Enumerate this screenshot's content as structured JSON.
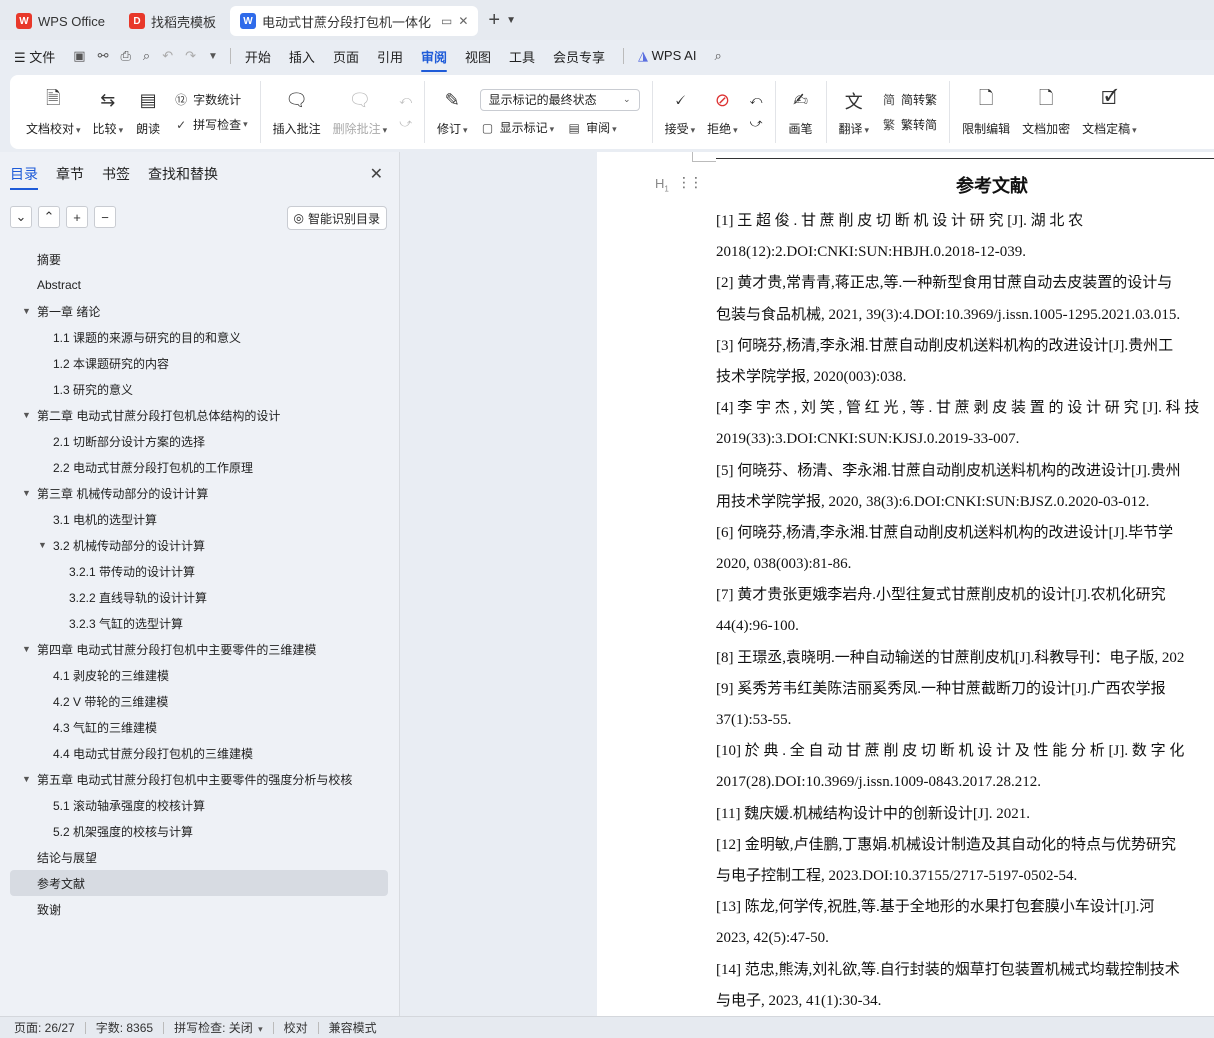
{
  "tabs": [
    {
      "label": "WPS Office",
      "icon": "wps-logo-icon",
      "color": "#e8382a"
    },
    {
      "label": "找稻壳模板",
      "icon": "docer-icon",
      "color": "#e8382a"
    },
    {
      "label": "电动式甘蔗分段打包机一体化",
      "icon": "writer-icon",
      "color": "#2f6bea",
      "active": true
    }
  ],
  "menu": {
    "file": "文件",
    "items": [
      "开始",
      "插入",
      "页面",
      "引用",
      "审阅",
      "视图",
      "工具",
      "会员专享"
    ],
    "active": "审阅",
    "ai": "WPS AI"
  },
  "ribbon": {
    "proofread": "文档校对",
    "compare": "比较",
    "read_aloud": "朗读",
    "word_count": "字数统计",
    "spell_check": "拼写检查",
    "insert_comment": "插入批注",
    "delete_comment": "删除批注",
    "revise": "修订",
    "markup_state": "显示标记的最终状态",
    "show_markup": "显示标记",
    "review": "审阅",
    "accept": "接受",
    "reject": "拒绝",
    "brush": "画笔",
    "translate": "翻译",
    "to_traditional": "简转繁",
    "to_simplified": "繁转简",
    "restrict_edit": "限制编辑",
    "encrypt": "文档加密",
    "finalize": "文档定稿"
  },
  "nav": {
    "tabs": [
      "目录",
      "章节",
      "书签",
      "查找和替换"
    ],
    "active_tab": "目录",
    "smart_button": "智能识别目录",
    "toc": [
      {
        "label": "摘要",
        "level": 1,
        "expand": false
      },
      {
        "label": "Abstract",
        "level": 1,
        "expand": false
      },
      {
        "label": "第一章  绪论",
        "level": 1,
        "expand": true
      },
      {
        "label": "1.1  课题的来源与研究的目的和意义",
        "level": 2,
        "expand": false
      },
      {
        "label": "1.2  本课题研究的内容",
        "level": 2,
        "expand": false
      },
      {
        "label": "1.3  研究的意义",
        "level": 2,
        "expand": false
      },
      {
        "label": "第二章  电动式甘蔗分段打包机总体结构的设计",
        "level": 1,
        "expand": true
      },
      {
        "label": "2.1 切断部分设计方案的选择",
        "level": 2,
        "expand": false
      },
      {
        "label": "2.2 电动式甘蔗分段打包机的工作原理",
        "level": 2,
        "expand": false
      },
      {
        "label": "第三章  机械传动部分的设计计算",
        "level": 1,
        "expand": true
      },
      {
        "label": "3.1 电机的选型计算",
        "level": 2,
        "expand": false
      },
      {
        "label": "3.2  机械传动部分的设计计算",
        "level": 2,
        "expand": true
      },
      {
        "label": "3.2.1  带传动的设计计算",
        "level": 3,
        "expand": false
      },
      {
        "label": "3.2.2 直线导轨的设计计算",
        "level": 3,
        "expand": false
      },
      {
        "label": "3.2.3 气缸的选型计算",
        "level": 3,
        "expand": false
      },
      {
        "label": "第四章  电动式甘蔗分段打包机中主要零件的三维建模",
        "level": 1,
        "expand": true
      },
      {
        "label": "4.1 剥皮轮的三维建模",
        "level": 2,
        "expand": false
      },
      {
        "label": "4.2 V 带轮的三维建模",
        "level": 2,
        "expand": false
      },
      {
        "label": "4.3 气缸的三维建模",
        "level": 2,
        "expand": false
      },
      {
        "label": "4.4 电动式甘蔗分段打包机的三维建模",
        "level": 2,
        "expand": false
      },
      {
        "label": "第五章  电动式甘蔗分段打包机中主要零件的强度分析与校核",
        "level": 1,
        "expand": true
      },
      {
        "label": "5.1 滚动轴承强度的校核计算",
        "level": 2,
        "expand": false
      },
      {
        "label": "5.2 机架强度的校核与计算",
        "level": 2,
        "expand": false
      },
      {
        "label": "结论与展望",
        "level": 1,
        "expand": false
      },
      {
        "label": "参考文献",
        "level": 1,
        "expand": false,
        "selected": true
      },
      {
        "label": "致谢",
        "level": 1,
        "expand": false
      }
    ]
  },
  "document": {
    "heading_marker": "H",
    "title": "参考文献",
    "lines": [
      "[1]  王 超 俊 . 甘 蔗 削 皮 切 断 机 设 计 研 究 [J]. 湖 北 农",
      "2018(12):2.DOI:CNKI:SUN:HBJH.0.2018-12-039.",
      "[2]  黄才贵,常青青,蒋正忠,等.一种新型食用甘蔗自动去皮装置的设计与",
      "包装与食品机械, 2021, 39(3):4.DOI:10.3969/j.issn.1005-1295.2021.03.015.",
      "[3]  何晓芬,杨清,李永湘.甘蔗自动削皮机送料机构的改进设计[J].贵州工",
      "技术学院学报, 2020(003):038.",
      "[4]  李 宇 杰 , 刘 笑 , 管 红 光 , 等 . 甘 蔗 剥 皮 装 置 的 设 计 研 究 [J]. 科 技",
      "2019(33):3.DOI:CNKI:SUN:KJSJ.0.2019-33-007.",
      "[5]  何晓芬、杨清、李永湘.甘蔗自动削皮机送料机构的改进设计[J].贵州",
      "用技术学院学报, 2020, 38(3):6.DOI:CNKI:SUN:BJSZ.0.2020-03-012.",
      "[6]  何晓芬,杨清,李永湘.甘蔗自动削皮机送料机构的改进设计[J].毕节学",
      "2020, 038(003):81-86.",
      "[7]  黄才贵张更娥李岩舟.小型往复式甘蔗削皮机的设计[J].农机化研究",
      "44(4):96-100.",
      "[8]  王璟丞,袁晓明.一种自动输送的甘蔗削皮机[J].科教导刊：电子版, 202",
      "[9]  奚秀芳韦红美陈洁丽奚秀凤.一种甘蔗截断刀的设计[J].广西农学报",
      "37(1):53-55.",
      "[10]  於 典 . 全 自 动 甘 蔗 削 皮 切 断 机 设 计 及 性 能 分 析 [J]. 数 字 化",
      "2017(28).DOI:10.3969/j.issn.1009-0843.2017.28.212.",
      "[11]  魏庆媛.机械结构设计中的创新设计[J].    2021.",
      "[12]  金明敏,卢佳鹏,丁惠娟.机械设计制造及其自动化的特点与优势研究",
      "与电子控制工程, 2023.DOI:10.37155/2717-5197-0502-54.",
      "[13]  陈龙,何学传,祝胜,等.基于全地形的水果打包套膜小车设计[J].河",
      "2023, 42(5):47-50.",
      "[14]  范忠,熊涛,刘礼欲,等.自行封装的烟草打包装置机械式均载控制技术",
      "与电子, 2023, 41(1):30-34."
    ]
  },
  "status": {
    "page": "页面: 26/27",
    "words": "字数: 8365",
    "spell": "拼写检查: 关闭",
    "proof": "校对",
    "compat": "兼容模式"
  }
}
